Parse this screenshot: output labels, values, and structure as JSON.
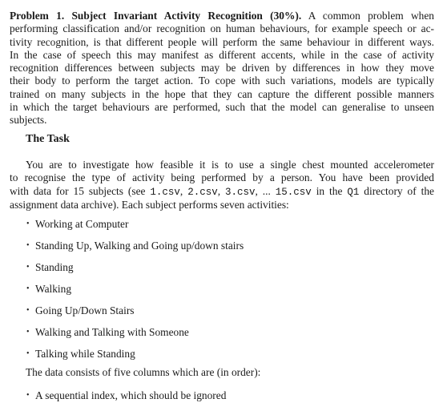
{
  "problem": {
    "title": "Problem 1. Subject Invariant Activity Recognition (30%).",
    "intro_lines": [
      "A common problem when",
      "performing classification and/or recognition on human behaviours, for example speech or ac-",
      "tivity recognition, is that different people will perform the same behaviour in different ways.",
      "In the case of speech this may manifest as different accents, while in the case of activity",
      "recognition differences between subjects may be driven by differences in how they move",
      "their body to perform the target action. To cope with such variations, models are typically",
      "trained on many subjects in the hope that they can capture the different possible manners",
      "in which the target behaviours are performed, such that the model can generalise to unseen",
      "subjects."
    ]
  },
  "task": {
    "heading": "The Task",
    "para_lines": [
      "You are to investigate how feasible it is to use a single chest mounted accelerometer",
      "to recognise the type of activity being performed by a person.  You have been provided"
    ],
    "line3_pre": "with data for 15 subjects (see ",
    "files": [
      "1.csv",
      "2.csv",
      "3.csv",
      "15.csv"
    ],
    "sep1": ", ",
    "sep2": ", ",
    "sep3": ", ... ",
    "line3_mid": " in the ",
    "directory": "Q1",
    "line3_post": " directory of the",
    "line4": "assignment data archive). Each subject performs seven activities:",
    "activities": [
      "Working at Computer",
      "Standing Up, Walking and Going up/down stairs",
      "Standing",
      "Walking",
      "Going Up/Down Stairs",
      "Walking and Talking with Someone",
      "Talking while Standing"
    ],
    "columns_intro": "The data consists of five columns which are (in order):",
    "columns": [
      "A sequential index, which should be ignored"
    ],
    "bullet_glyph": "•"
  }
}
